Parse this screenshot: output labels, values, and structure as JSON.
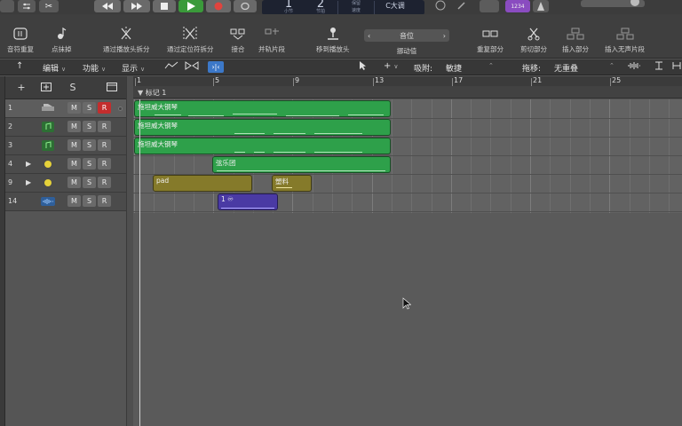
{
  "transport": {
    "lcd": {
      "bar": "1",
      "beat": "2",
      "bar_label": "小节",
      "beat_label": "节拍",
      "tempo_label": "保留",
      "tempo_sub": "速度",
      "key": "C大调"
    },
    "count_in": "1234"
  },
  "toolbar": {
    "items": [
      {
        "label": "音符重复",
        "icon": "note-repeat-icon"
      },
      {
        "label": "点抹掉",
        "icon": "point-erase-icon"
      },
      {
        "label": "通过播放头拆分",
        "icon": "split-playhead-icon"
      },
      {
        "label": "通过定位符拆分",
        "icon": "split-locators-icon"
      },
      {
        "label": "接合",
        "icon": "join-icon"
      },
      {
        "label": "并轨片段",
        "icon": "bounce-regions-icon"
      },
      {
        "label": "移到播放头",
        "icon": "move-to-playhead-icon"
      },
      {
        "label": "重复部分",
        "icon": "repeat-section-icon"
      },
      {
        "label": "剪切部分",
        "icon": "cut-section-icon"
      },
      {
        "label": "插入部分",
        "icon": "insert-section-icon"
      },
      {
        "label": "插入无声片段",
        "icon": "insert-silence-icon"
      }
    ],
    "nudge": {
      "value": "音位",
      "label": "挪动值"
    }
  },
  "menubar": {
    "edit": "编辑",
    "functions": "功能",
    "view": "显示",
    "snap_label": "吸附:",
    "snap_value": "敏捷",
    "drag_label": "拖移:",
    "drag_value": "无重叠"
  },
  "track_header": {
    "solo_label": "S"
  },
  "tracks": [
    {
      "num": "1",
      "icon": "piano-icon",
      "m": "M",
      "s": "S",
      "r": "R",
      "rec_armed": true,
      "selected": true
    },
    {
      "num": "2",
      "icon": "midi-icon",
      "m": "M",
      "s": "S",
      "r": "R",
      "rec_armed": false,
      "selected": false
    },
    {
      "num": "3",
      "icon": "midi-icon",
      "m": "M",
      "s": "S",
      "r": "R",
      "rec_armed": false,
      "selected": false
    },
    {
      "num": "4",
      "icon": "folder-stack-icon",
      "m": "M",
      "s": "S",
      "r": "R",
      "rec_armed": false,
      "selected": false
    },
    {
      "num": "9",
      "icon": "folder-stack-icon",
      "m": "M",
      "s": "S",
      "r": "R",
      "rec_armed": false,
      "selected": false
    },
    {
      "num": "14",
      "icon": "audio-waveform-icon",
      "m": "M",
      "s": "S",
      "r": "R",
      "rec_armed": false,
      "selected": false
    }
  ],
  "ruler": {
    "bars": [
      "1",
      "5",
      "9",
      "13",
      "17",
      "21",
      "25"
    ],
    "marker": "标记 1"
  },
  "regions": [
    {
      "name": "施坦威大钢琴",
      "color": "#2ea04a"
    },
    {
      "name": "施坦威大钢琴",
      "color": "#2ea04a"
    },
    {
      "name": "施坦威大钢琴",
      "color": "#2ea04a"
    },
    {
      "name": "弦乐团",
      "color": "#2ea04a"
    },
    {
      "name": "pad",
      "color": "#857a2a"
    },
    {
      "name": "塑料",
      "color": "#857a2a"
    },
    {
      "name": "1 ♾",
      "color": "#4a3aa4"
    }
  ]
}
